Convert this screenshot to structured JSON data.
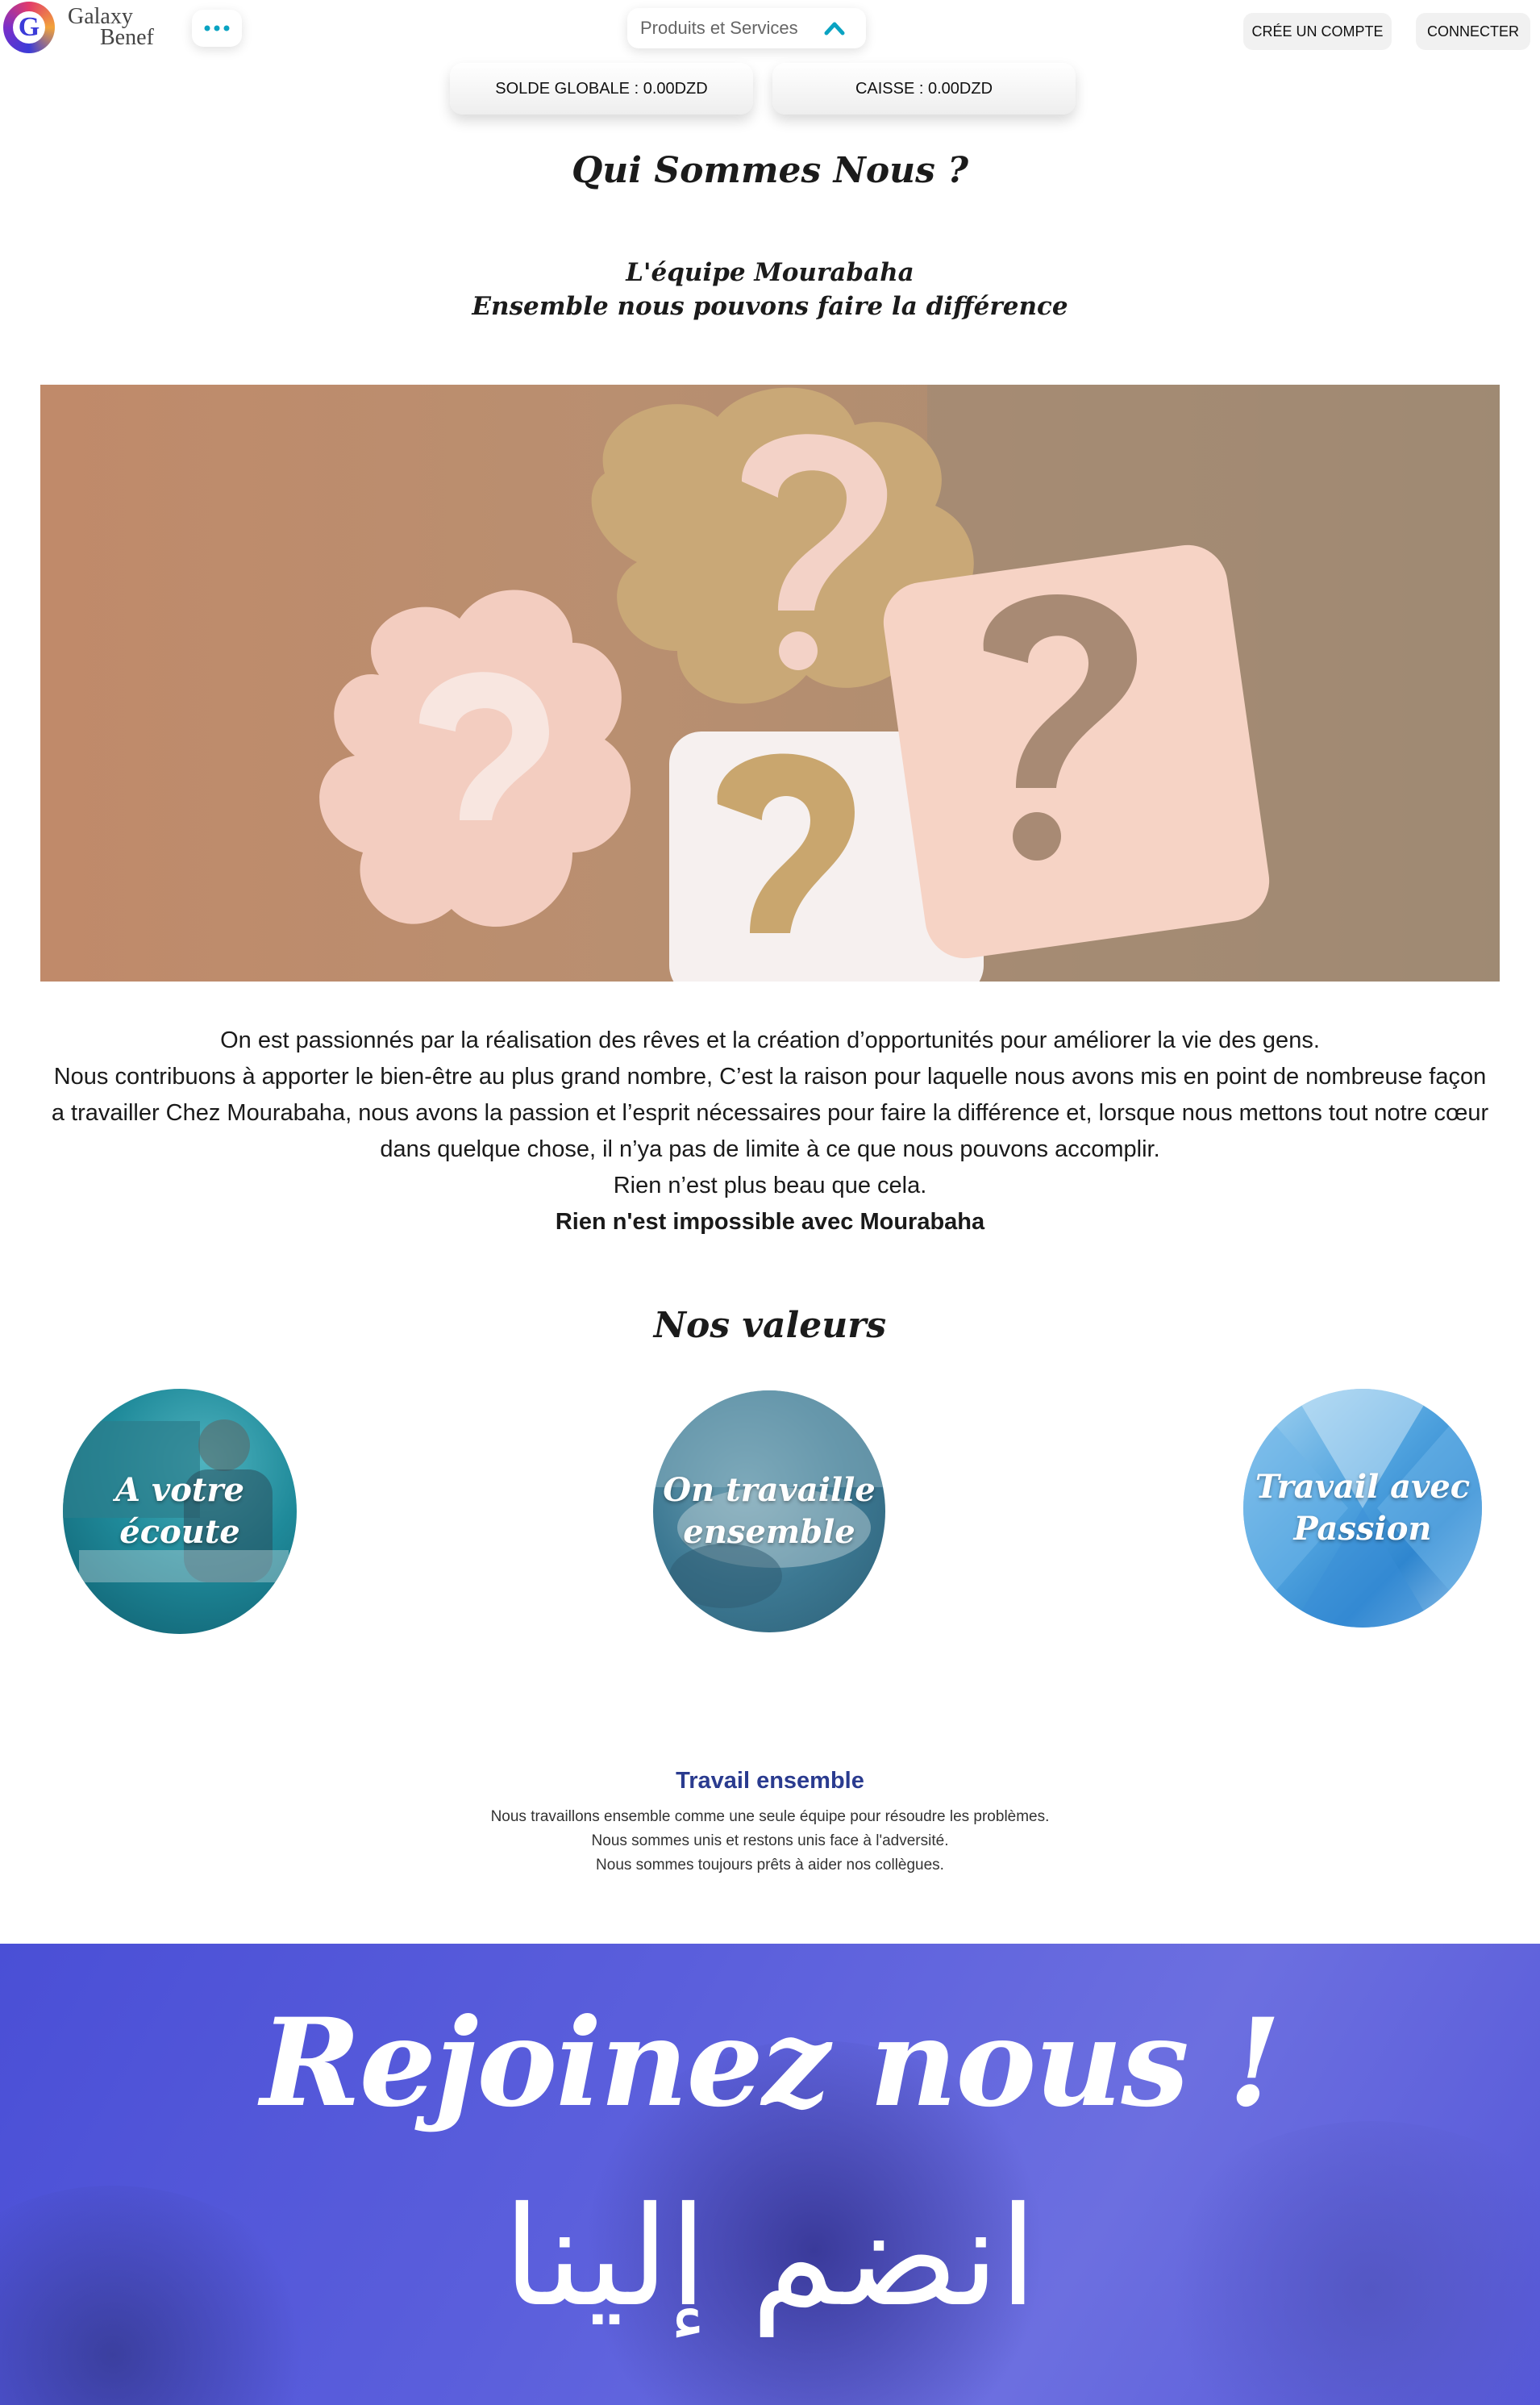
{
  "header": {
    "logo_letter": "G",
    "logo_line1": "Galaxy",
    "logo_line2": "Benef",
    "menu_icon": "more-dots-icon",
    "products_label": "Produits et Services",
    "products_icon": "chevron-up-icon",
    "create_account": "CRÉE UN COMPTE",
    "connect": "CONNECTER"
  },
  "balances": {
    "global": "SOLDE GLOBALE : 0.00DZD",
    "cash": "CAISSE : 0.00DZD"
  },
  "about": {
    "title": "Qui Sommes Nous ?",
    "subtitle1": "L'équipe Mourabaha",
    "subtitle2": "Ensemble nous pouvons faire la différence",
    "paragraph": [
      "On est passionnés par la réalisation des rêves et la création d’opportunités pour améliorer la vie des gens.",
      "Nous contribuons à apporter le bien-être au plus grand nombre, C’est la raison pour laquelle nous avons mis en point de nombreuse façon a travailler Chez Mourabaha, nous avons la passion et l’esprit nécessaires pour faire la différence et, lorsque nous mettons tout notre cœur dans quelque chose, il n’ya pas de limite à ce que nous pouvons accomplir.",
      "Rien n’est plus beau que cela."
    ],
    "tagline": "Rien n'est impossible avec Mourabaha"
  },
  "values": {
    "title": "Nos valeurs",
    "items": [
      {
        "label": "A votre écoute"
      },
      {
        "label": "On travaille ensemble"
      },
      {
        "label": "Travail avec Passion"
      }
    ],
    "detail_title": "Travail ensemble",
    "detail_lines": [
      "Nous travaillons ensemble comme une seule équipe pour résoudre les problèmes.",
      "Nous sommes unis et restons unis face à l'adversité.",
      "Nous sommes toujours prêts à aider nos collègues."
    ]
  },
  "join": {
    "french": "Rejoinez nous !",
    "arabic": "انضم إلينا"
  },
  "colors": {
    "accent": "#0aa3c2",
    "heading_blue": "#2a3b8f",
    "join_bg": "#5b5fdc"
  }
}
